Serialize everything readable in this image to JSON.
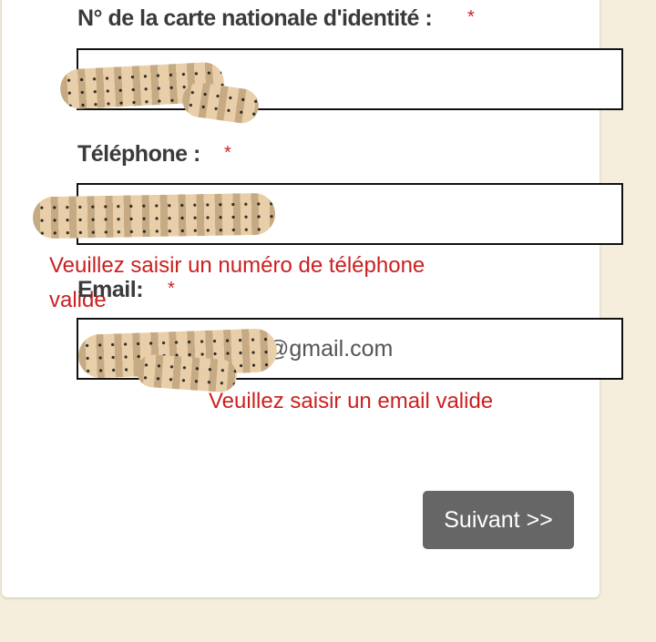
{
  "form": {
    "id_card": {
      "label": "N° de la carte nationale d'identité :",
      "required_mark": "*",
      "value": ""
    },
    "phone": {
      "label": "Téléphone :",
      "required_mark": "*",
      "value": "",
      "error": "Veuillez saisir un numéro de téléphone valide"
    },
    "email": {
      "label": "Email:",
      "required_mark": "*",
      "value_visible_suffix": "@gmail.com",
      "error": "Veuillez saisir un email valide"
    },
    "next_button_label": "Suivant >>"
  },
  "colors": {
    "page_background": "#f5eedc",
    "error_text": "#cc1f1f",
    "button_background": "#666666"
  }
}
